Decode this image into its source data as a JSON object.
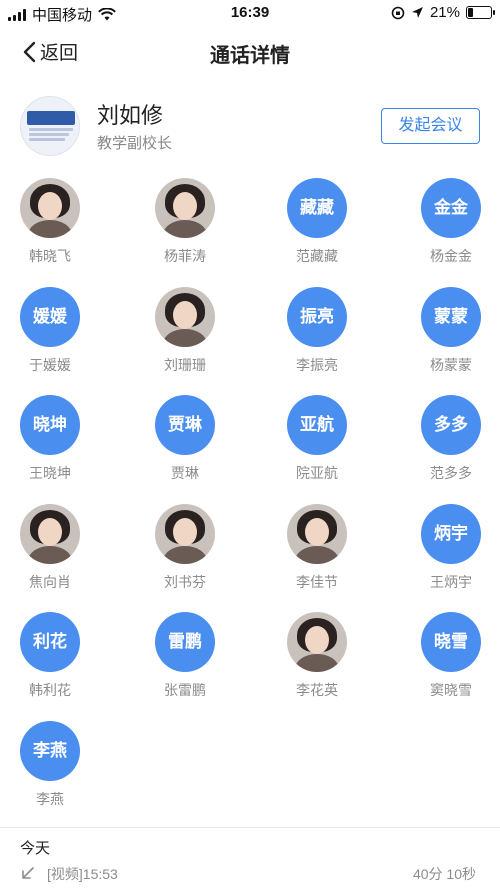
{
  "status_bar": {
    "carrier": "中国移动",
    "time": "16:39",
    "battery_percent": "21%",
    "battery_level": 0.21
  },
  "nav": {
    "back_label": "返回",
    "title": "通话详情"
  },
  "contact": {
    "name": "刘如修",
    "role": "教学副校长",
    "action_label": "发起会议"
  },
  "members": [
    {
      "name": "韩晓飞",
      "avatar_text": "",
      "photo": true
    },
    {
      "name": "杨菲涛",
      "avatar_text": "",
      "photo": true
    },
    {
      "name": "范藏藏",
      "avatar_text": "藏藏",
      "photo": false
    },
    {
      "name": "杨金金",
      "avatar_text": "金金",
      "photo": false
    },
    {
      "name": "于媛媛",
      "avatar_text": "媛媛",
      "photo": false
    },
    {
      "name": "刘珊珊",
      "avatar_text": "",
      "photo": true
    },
    {
      "name": "李振亮",
      "avatar_text": "振亮",
      "photo": false
    },
    {
      "name": "杨蒙蒙",
      "avatar_text": "蒙蒙",
      "photo": false
    },
    {
      "name": "王晓坤",
      "avatar_text": "晓坤",
      "photo": false
    },
    {
      "name": "贾琳",
      "avatar_text": "贾琳",
      "photo": false
    },
    {
      "name": "院亚航",
      "avatar_text": "亚航",
      "photo": false
    },
    {
      "name": "范多多",
      "avatar_text": "多多",
      "photo": false
    },
    {
      "name": "焦向肖",
      "avatar_text": "",
      "photo": true
    },
    {
      "name": "刘书芬",
      "avatar_text": "",
      "photo": true
    },
    {
      "name": "李佳节",
      "avatar_text": "",
      "photo": true
    },
    {
      "name": "王炳宇",
      "avatar_text": "炳宇",
      "photo": false
    },
    {
      "name": "韩利花",
      "avatar_text": "利花",
      "photo": false
    },
    {
      "name": "张雷鹏",
      "avatar_text": "雷鹏",
      "photo": false
    },
    {
      "name": "李花英",
      "avatar_text": "",
      "photo": true
    },
    {
      "name": "窦晓雪",
      "avatar_text": "晓雪",
      "photo": false
    },
    {
      "name": "李燕",
      "avatar_text": "李燕",
      "photo": false
    }
  ],
  "record": {
    "date": "今天",
    "type_time": "[视频]15:53",
    "duration": "40分 10秒"
  },
  "colors": {
    "accent": "#3a86e8",
    "avatar_bg": "#4a8ef0"
  }
}
